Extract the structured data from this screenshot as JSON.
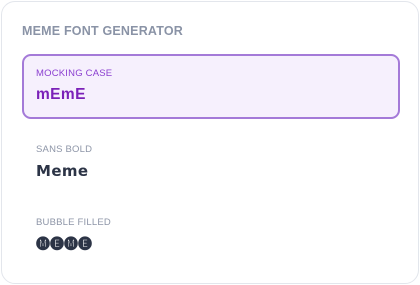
{
  "generator": {
    "title": "MEME FONT GENERATOR",
    "options": [
      {
        "label": "MOCKING CASE",
        "sample": "mEmE",
        "selected": true
      },
      {
        "label": "SANS BOLD",
        "sample": "𝗠𝗲𝗺𝗲",
        "selected": false
      },
      {
        "label": "BUBBLE FILLED",
        "sample": "🅜🅔🅜🅔",
        "selected": false
      }
    ]
  },
  "colors": {
    "selected_border": "#a47ad8",
    "selected_background": "#f6f0fd",
    "selected_text": "#7b21b8"
  }
}
